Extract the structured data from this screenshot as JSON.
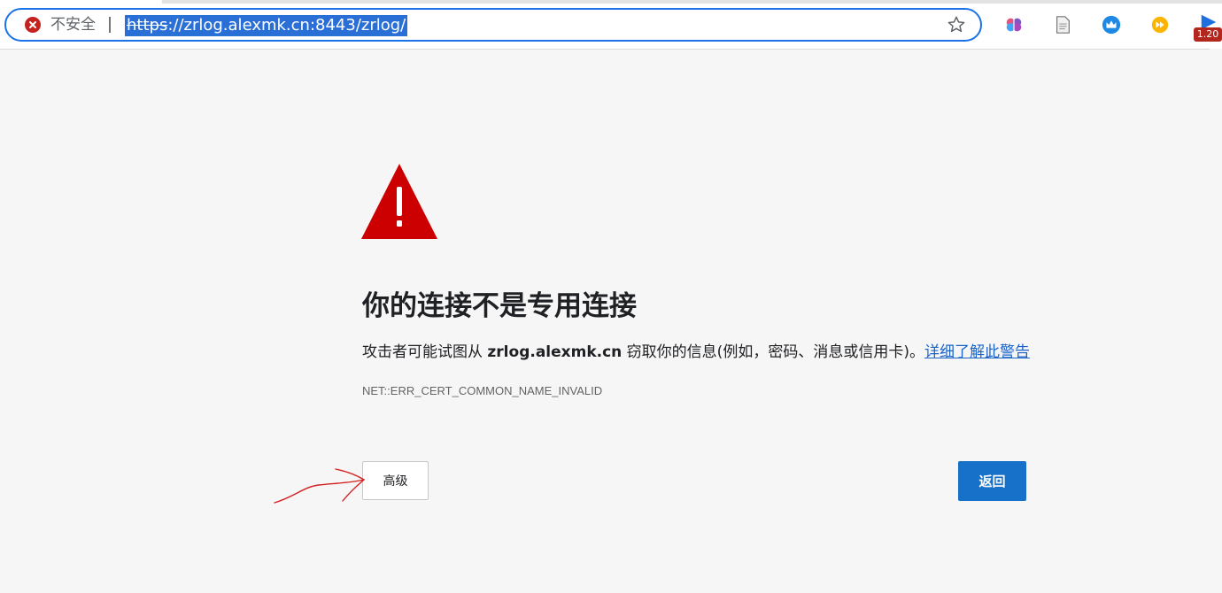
{
  "browser": {
    "security_label": "不安全",
    "url_scheme": "https",
    "url_rest": "://zrlog.alexmk.cn:8443/zrlog/",
    "extension_badge": "1.20"
  },
  "interstitial": {
    "headline": "你的连接不是专用连接",
    "explanation_prefix": "攻击者可能试图从 ",
    "explanation_host": "zrlog.alexmk.cn",
    "explanation_suffix": " 窃取你的信息(例如，密码、消息或信用卡)。",
    "learn_more_link": "详细了解此警告",
    "error_code": "NET::ERR_CERT_COMMON_NAME_INVALID",
    "advanced_button": "高级",
    "back_button": "返回"
  },
  "icons": {
    "security": "error-circle-icon",
    "bookmark": "star-icon",
    "extensions": [
      "brain-icon",
      "document-icon",
      "crown-icon",
      "forward-icon",
      "play-icon"
    ],
    "warning": "warning-triangle-icon"
  },
  "colors": {
    "accent": "#1a73e8",
    "danger": "#c5221f",
    "warning_red": "#cc0000",
    "primary_button": "#1871c8",
    "page_background": "#f6f6f6",
    "annotation": "#d22020"
  }
}
